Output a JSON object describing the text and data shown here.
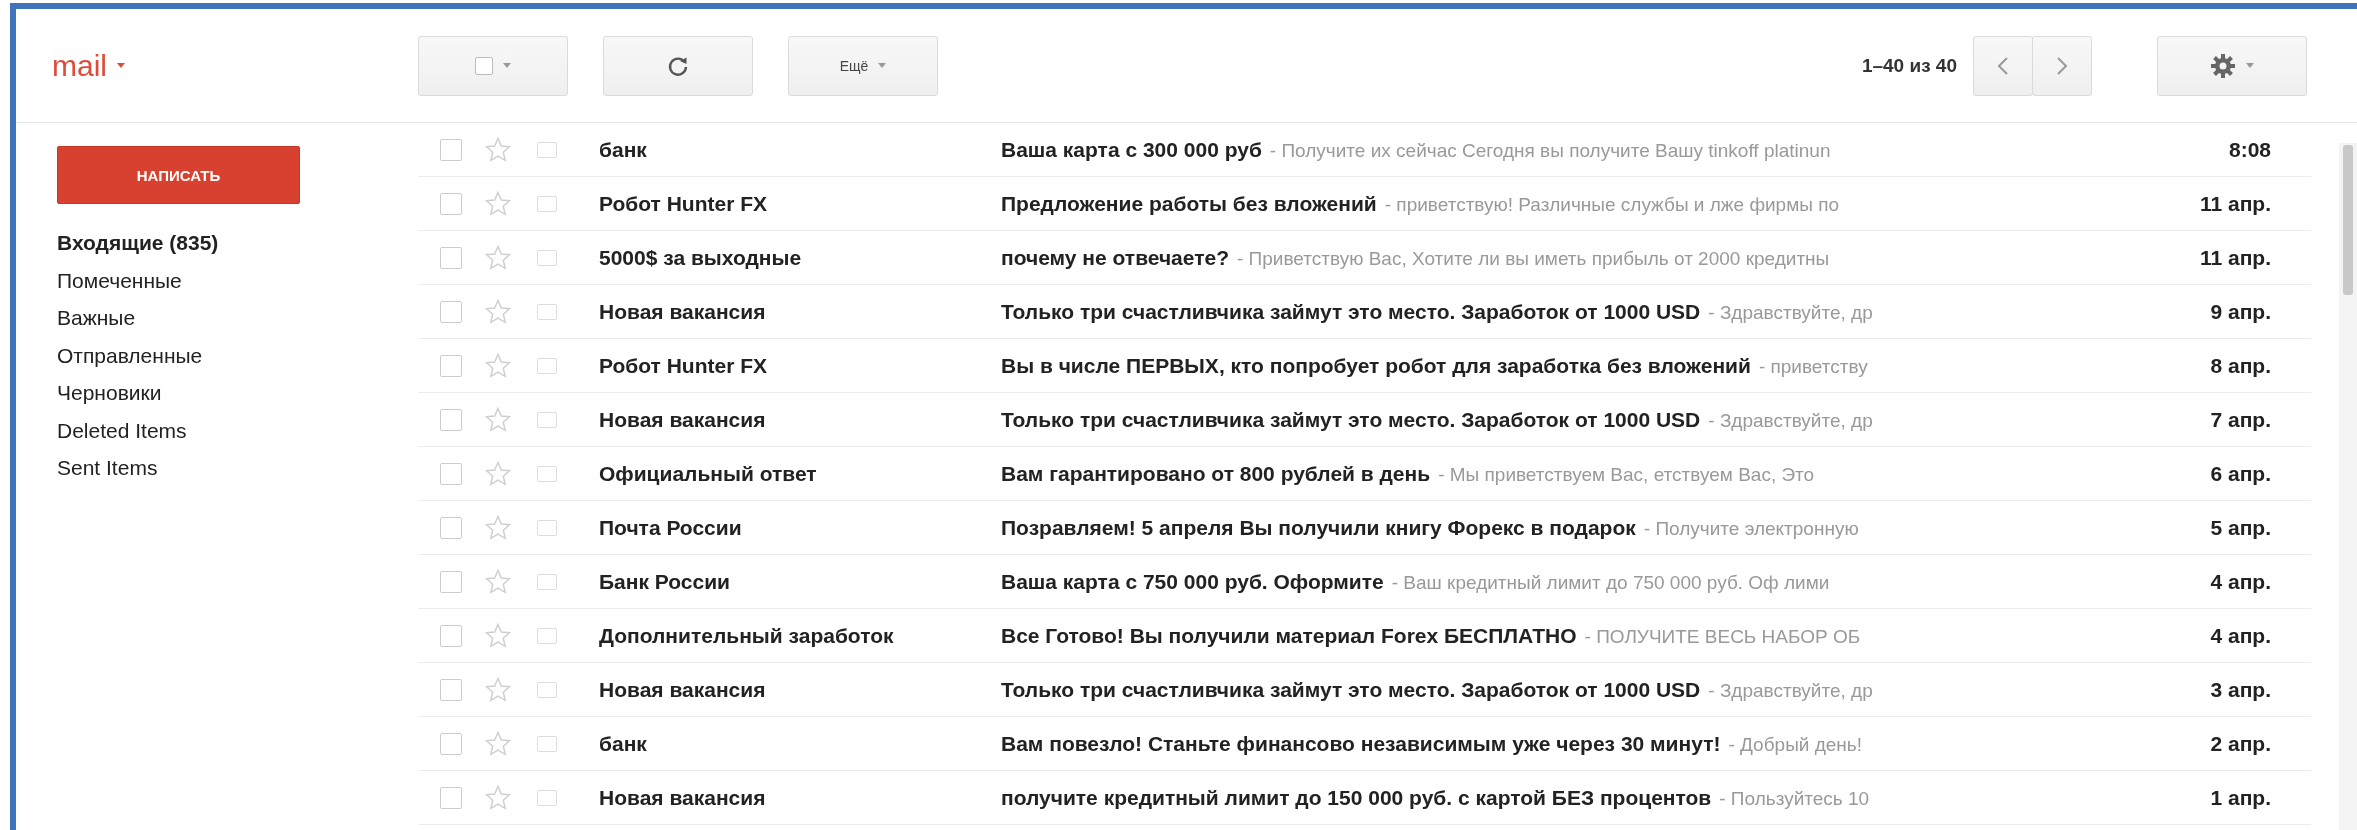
{
  "logo": {
    "label": "mail"
  },
  "toolbar": {
    "more_label": "Ещё",
    "page_range": "1–40 из 40"
  },
  "compose": {
    "label": "НАПИСАТЬ"
  },
  "folders": [
    {
      "label": "Входящие (835)",
      "selected": true
    },
    {
      "label": "Помеченные",
      "selected": false
    },
    {
      "label": "Важные",
      "selected": false
    },
    {
      "label": "Отправленные",
      "selected": false
    },
    {
      "label": "Черновики",
      "selected": false
    },
    {
      "label": "Deleted Items",
      "selected": false
    },
    {
      "label": "Sent Items",
      "selected": false
    }
  ],
  "messages": [
    {
      "checked": false,
      "starred": false,
      "sender": "банк",
      "subject": "Ваша карта с 300 000 руб",
      "snippet": "- Получите их сейчас Сегодня вы получите Вашу tinkoff platinun",
      "date": "8:08"
    },
    {
      "checked": false,
      "starred": false,
      "sender": "Робот Hunter FX",
      "subject": "Предложение работы без вложений",
      "snippet": "- приветствую! Различные службы и лже фирмы по",
      "date": "11 апр."
    },
    {
      "checked": false,
      "starred": false,
      "sender": "5000$ за выходные",
      "subject": "почему не отвечаете?",
      "snippet": "- Приветствую Вас, Хотите ли вы иметь прибыль от 2000 кредитны",
      "date": "11 апр."
    },
    {
      "checked": false,
      "starred": false,
      "sender": "Новая вакансия",
      "subject": "Только три счастливчика займут это место. Заработок от 1000 USD",
      "snippet": "- Здравствуйте, др",
      "date": "9 апр."
    },
    {
      "checked": false,
      "starred": false,
      "sender": "Робот Hunter FX",
      "subject": "Вы в числе ПЕРВЫХ, кто попробует робот для заработка без вложений",
      "snippet": "- приветству",
      "date": "8 апр."
    },
    {
      "checked": false,
      "starred": false,
      "sender": "Новая вакансия",
      "subject": "Только три счастливчика займут это место. Заработок от 1000 USD",
      "snippet": "- Здравствуйте, др",
      "date": "7 апр."
    },
    {
      "checked": false,
      "starred": false,
      "sender": "Официальный ответ",
      "subject": "Вам гарантировано от 800 рублей в день",
      "snippet": "- Мы приветствуем Вас, етствуем Вас, Это",
      "date": "6 апр."
    },
    {
      "checked": false,
      "starred": false,
      "sender": "Почта России",
      "subject": "Позравляем! 5 апреля Вы получили книгу Форекс в подарок",
      "snippet": "- Получите электронную",
      "date": "5 апр."
    },
    {
      "checked": false,
      "starred": false,
      "sender": "Банк России",
      "subject": "Ваша карта с 750 000 руб. Оформите",
      "snippet": "- Ваш кредитный лимит до 750 000 руб. Оф лими",
      "date": "4 апр."
    },
    {
      "checked": false,
      "starred": false,
      "sender": "Дополнительный заработок",
      "subject": "Все Готово! Вы получили материал Forex БЕСПЛАТНО",
      "snippet": "- ПОЛУЧИТЕ ВЕСЬ НАБОР ОБ",
      "date": "4 апр."
    },
    {
      "checked": false,
      "starred": false,
      "sender": "Новая вакансия",
      "subject": "Только три счастливчика займут это место. Заработок от 1000 USD",
      "snippet": "- Здравствуйте, др",
      "date": "3 апр."
    },
    {
      "checked": false,
      "starred": false,
      "sender": "банк",
      "subject": "Вам повезло! Станьте финансово независимым уже через 30 минут!",
      "snippet": "- Добрый день!",
      "date": "2 апр."
    },
    {
      "checked": false,
      "starred": false,
      "sender": "Новая вакансия",
      "subject": "получите кредитный лимит до 150 000 руб. с картой БЕЗ процентов",
      "snippet": "- Пользуйтесь 10",
      "date": "1 апр."
    }
  ]
}
